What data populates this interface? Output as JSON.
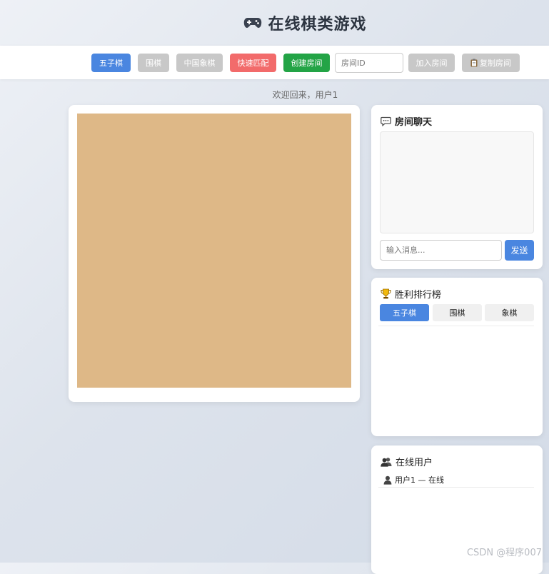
{
  "header": {
    "title": "在线棋类游戏",
    "icon": "gamepad-icon"
  },
  "toolbar": {
    "gomoku_label": "五子棋",
    "go_label": "围棋",
    "chess_label": "中国象棋",
    "quick_match_label": "快速匹配",
    "create_room_label": "创建房间",
    "room_id_placeholder": "房间ID",
    "join_room_label": "加入房间",
    "copy_room_label": "复制房间",
    "colors": {
      "active": "#4a86e0",
      "disabled": "#c8c8c8",
      "quick_match": "#f26b6b",
      "create_room": "#23a446"
    }
  },
  "welcome": "欢迎回来，用户1",
  "board": {
    "color": "#deb887"
  },
  "chat": {
    "title": "房间聊天",
    "icon": "chat-bubble-icon",
    "input_placeholder": "输入消息...",
    "send_label": "发送"
  },
  "leaderboard": {
    "title": "胜利排行榜",
    "icon": "trophy-icon",
    "tabs": [
      {
        "label": "五子棋",
        "active": true
      },
      {
        "label": "围棋",
        "active": false
      },
      {
        "label": "象棋",
        "active": false
      }
    ]
  },
  "online": {
    "title": "在线用户",
    "icon": "users-icon",
    "users": [
      {
        "name": "用户1 — 在线",
        "icon": "user-icon"
      }
    ]
  },
  "watermark": "CSDN @程序007"
}
